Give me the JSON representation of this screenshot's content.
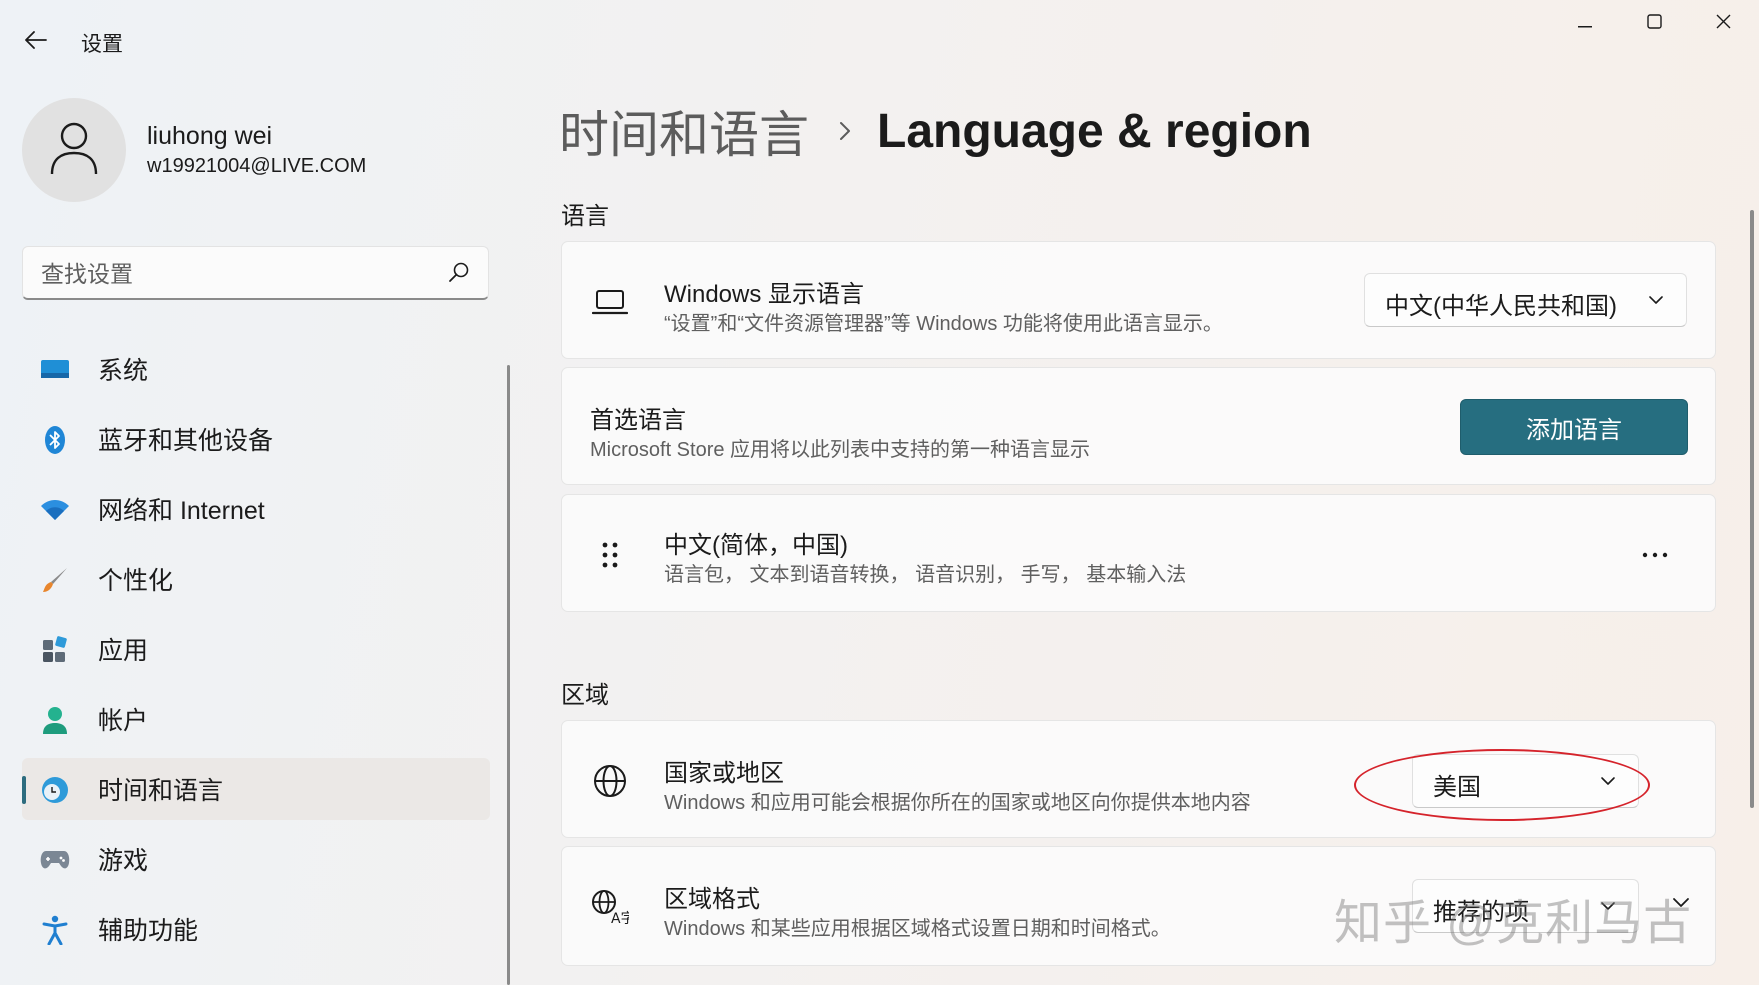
{
  "window": {
    "back_icon": "arrow-left-icon",
    "title": "设置",
    "controls": [
      "minimize-icon",
      "maximize-icon",
      "close-icon"
    ]
  },
  "profile": {
    "name": "liuhong wei",
    "email": "w19921004@LIVE.COM",
    "avatar_icon": "person-icon"
  },
  "search": {
    "placeholder": "查找设置",
    "icon": "search-icon"
  },
  "sidebar": {
    "active_index": 6,
    "items": [
      {
        "label": "系统",
        "icon": "monitor-icon"
      },
      {
        "label": "蓝牙和其他设备",
        "icon": "bluetooth-icon"
      },
      {
        "label": "网络和 Internet",
        "icon": "wifi-icon"
      },
      {
        "label": "个性化",
        "icon": "brush-icon"
      },
      {
        "label": "应用",
        "icon": "apps-icon"
      },
      {
        "label": "帐户",
        "icon": "account-icon"
      },
      {
        "label": "时间和语言",
        "icon": "time-language-icon"
      },
      {
        "label": "游戏",
        "icon": "gamepad-icon"
      },
      {
        "label": "辅助功能",
        "icon": "accessibility-icon"
      }
    ]
  },
  "breadcrumb": {
    "parent": "时间和语言",
    "current": "Language & region"
  },
  "language_section": {
    "title": "语言",
    "display_language": {
      "title": "Windows 显示语言",
      "description": "“设置”和“文件资源管理器”等 Windows 功能将使用此语言显示。",
      "selected": "中文(中华人民共和国)",
      "icon": "laptop-icon"
    },
    "preferred": {
      "title": "首选语言",
      "description": "Microsoft Store 应用将以此列表中支持的第一种语言显示",
      "button": "添加语言"
    },
    "installed_language": {
      "title": "中文(简体，中国)",
      "description": "语言包， 文本到语音转换， 语音识别， 手写， 基本输入法",
      "drag_icon": "drag-handle-icon",
      "more_icon": "more-icon"
    }
  },
  "region_section": {
    "title": "区域",
    "country": {
      "title": "国家或地区",
      "description": "Windows 和应用可能会根据你所在的国家或地区向你提供本地内容",
      "selected": "美国",
      "icon": "globe-icon"
    },
    "format": {
      "title": "区域格式",
      "description": "Windows 和某些应用根据区域格式设置日期和时间格式。",
      "selected": "推荐的项",
      "icon": "regional-format-icon"
    }
  },
  "annotation": {
    "color": "#d5232b"
  },
  "watermark": "知乎 @克利马古",
  "colors": {
    "accent": "#266e80",
    "text": "#1b1b1b",
    "secondary_text": "#5f5f5f"
  }
}
